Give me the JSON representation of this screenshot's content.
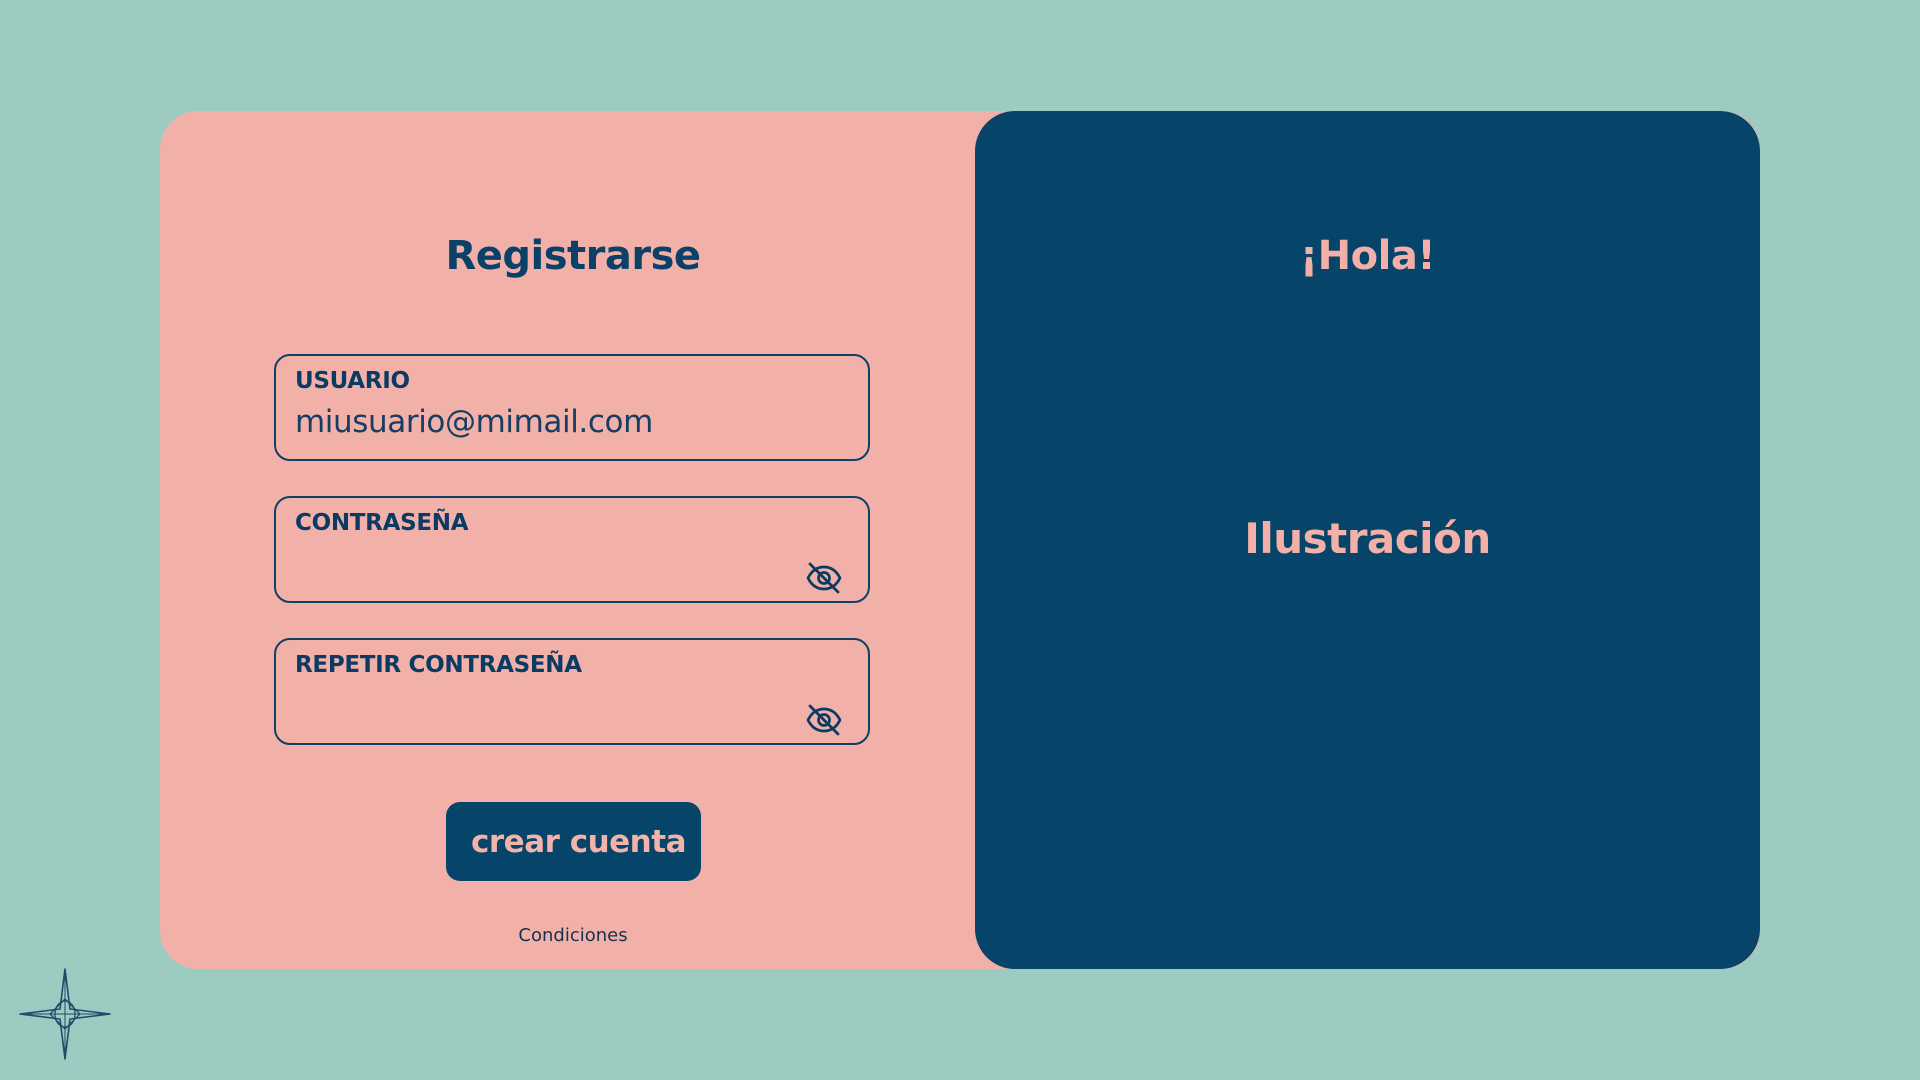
{
  "colors": {
    "background": "#9ccbc1",
    "form_panel": "#f1b1a9",
    "accent_navy": "#064469",
    "accent_pink": "#f2b0a8"
  },
  "register": {
    "title": "Registrarse",
    "fields": {
      "username": {
        "label": "USUARIO",
        "value": "miusuario@mimail.com"
      },
      "password": {
        "label": "CONTRASEÑA",
        "value": "",
        "toggle_icon": "eye-off-icon"
      },
      "repeat_password": {
        "label": "REPETIR CONTRASEÑA",
        "value": "",
        "toggle_icon": "eye-off-icon"
      }
    },
    "submit_label": "crear cuenta",
    "terms_link": "Condiciones"
  },
  "welcome": {
    "title": "¡Hola!",
    "illustration_label": "Ilustración"
  },
  "decoration": {
    "corner_icon": "compass-star-icon"
  }
}
